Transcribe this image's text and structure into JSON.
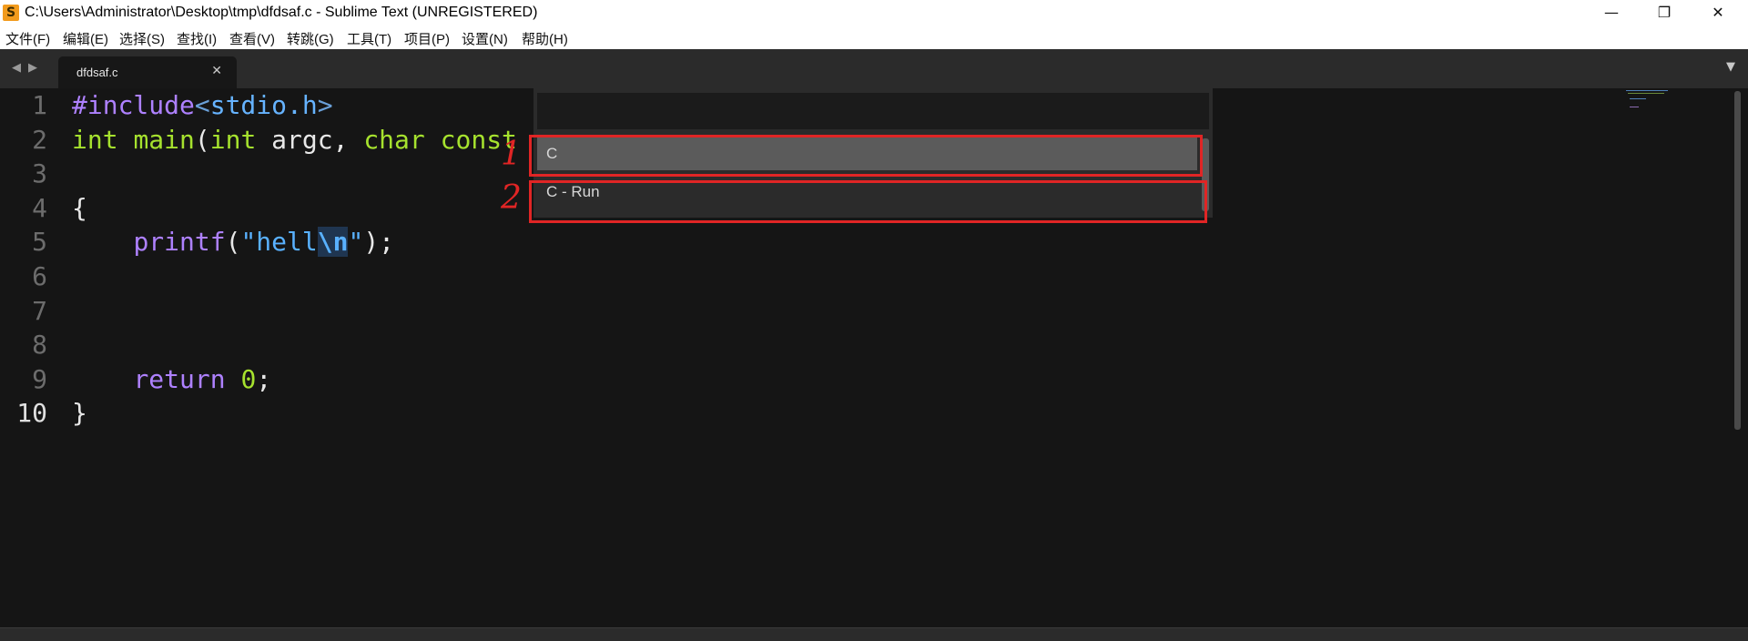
{
  "window": {
    "title": "C:\\Users\\Administrator\\Desktop\\tmp\\dfdsaf.c - Sublime Text (UNREGISTERED)",
    "app_icon_glyph": "S",
    "minimize_glyph": "—",
    "maximize_glyph": "❐",
    "close_glyph": "✕"
  },
  "menu": [
    "文件(F)",
    "编辑(E)",
    "选择(S)",
    "查找(I)",
    "查看(V)",
    "转跳(G)",
    "工具(T)",
    "项目(P)",
    "设置(N)",
    "帮助(H)"
  ],
  "tabs": {
    "prev_glyph": "◀",
    "next_glyph": "▶",
    "active_file": "dfdsaf.c",
    "close_glyph": "✕",
    "dropdown_glyph": "▼"
  },
  "editor": {
    "line_numbers": [
      "1",
      "2",
      "3",
      "4",
      "5",
      "6",
      "7",
      "8",
      "9",
      "10"
    ],
    "active_line": 10,
    "lines": {
      "l1": {
        "directive": "#include",
        "open": "<",
        "header": "stdio.h",
        "close": ">"
      },
      "l2": {
        "t1": "int",
        "sp1": " ",
        "name": "main",
        "paren": "(",
        "t2": "int",
        "mid": " argc, ",
        "t3": "char",
        "sp2": " ",
        "t4": "const"
      },
      "l4": {
        "text": "{"
      },
      "l5": {
        "indent": "    ",
        "fn": "printf",
        "open": "(",
        "str": "\"hell",
        "esc": "\\n",
        "str_end": "\"",
        "close": ");"
      },
      "l9": {
        "indent": "    ",
        "kw": "return",
        "sp": " ",
        "num": "0",
        "semi": ";"
      },
      "l10": {
        "text": "}"
      }
    }
  },
  "popup": {
    "items": [
      "C",
      "C - Run"
    ]
  },
  "annotations": {
    "n1": "1",
    "n2": "2",
    "color": "#e02525"
  },
  "colors": {
    "editor_bg": "#151515",
    "type_keyword": "#a6e22e",
    "preprocessor": "#ae81ff",
    "string": "#59b1ff"
  }
}
